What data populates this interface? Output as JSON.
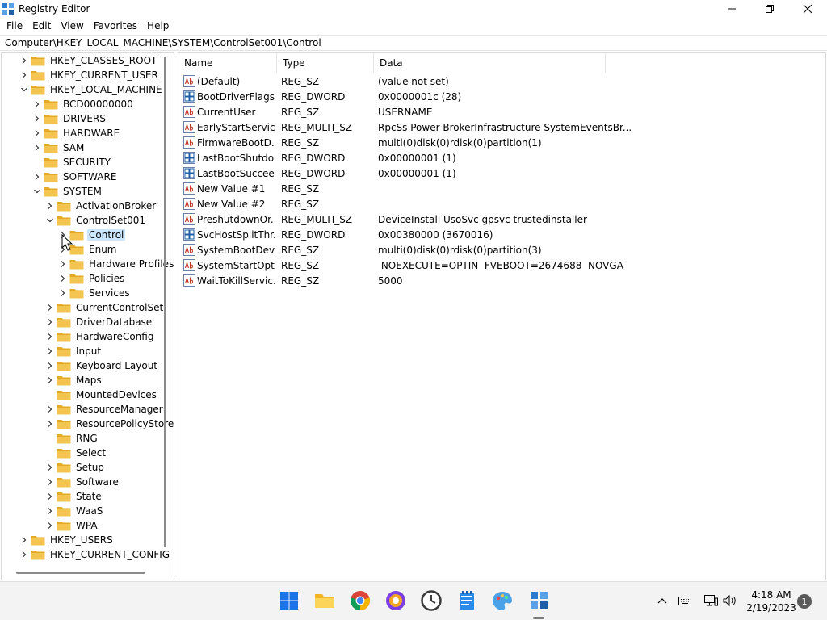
{
  "window": {
    "title": "Registry Editor"
  },
  "menu": [
    "File",
    "Edit",
    "View",
    "Favorites",
    "Help"
  ],
  "address": "Computer\\HKEY_LOCAL_MACHINE\\SYSTEM\\ControlSet001\\Control",
  "tree": [
    {
      "label": "HKEY_CLASSES_ROOT",
      "level": 0,
      "expander": "collapsed"
    },
    {
      "label": "HKEY_CURRENT_USER",
      "level": 0,
      "expander": "collapsed"
    },
    {
      "label": "HKEY_LOCAL_MACHINE",
      "level": 0,
      "expander": "expanded"
    },
    {
      "label": "BCD00000000",
      "level": 1,
      "expander": "collapsed"
    },
    {
      "label": "DRIVERS",
      "level": 1,
      "expander": "collapsed"
    },
    {
      "label": "HARDWARE",
      "level": 1,
      "expander": "collapsed"
    },
    {
      "label": "SAM",
      "level": 1,
      "expander": "collapsed"
    },
    {
      "label": "SECURITY",
      "level": 1,
      "expander": "none"
    },
    {
      "label": "SOFTWARE",
      "level": 1,
      "expander": "collapsed"
    },
    {
      "label": "SYSTEM",
      "level": 1,
      "expander": "expanded"
    },
    {
      "label": "ActivationBroker",
      "level": 2,
      "expander": "collapsed"
    },
    {
      "label": "ControlSet001",
      "level": 2,
      "expander": "expanded"
    },
    {
      "label": "Control",
      "level": 3,
      "expander": "collapsed",
      "selected": true
    },
    {
      "label": "Enum",
      "level": 3,
      "expander": "collapsed"
    },
    {
      "label": "Hardware Profiles",
      "level": 3,
      "expander": "collapsed"
    },
    {
      "label": "Policies",
      "level": 3,
      "expander": "collapsed"
    },
    {
      "label": "Services",
      "level": 3,
      "expander": "collapsed"
    },
    {
      "label": "CurrentControlSet",
      "level": 2,
      "expander": "collapsed"
    },
    {
      "label": "DriverDatabase",
      "level": 2,
      "expander": "collapsed"
    },
    {
      "label": "HardwareConfig",
      "level": 2,
      "expander": "collapsed"
    },
    {
      "label": "Input",
      "level": 2,
      "expander": "collapsed"
    },
    {
      "label": "Keyboard Layout",
      "level": 2,
      "expander": "collapsed"
    },
    {
      "label": "Maps",
      "level": 2,
      "expander": "collapsed"
    },
    {
      "label": "MountedDevices",
      "level": 2,
      "expander": "none"
    },
    {
      "label": "ResourceManager",
      "level": 2,
      "expander": "collapsed"
    },
    {
      "label": "ResourcePolicyStore",
      "level": 2,
      "expander": "collapsed"
    },
    {
      "label": "RNG",
      "level": 2,
      "expander": "none"
    },
    {
      "label": "Select",
      "level": 2,
      "expander": "none"
    },
    {
      "label": "Setup",
      "level": 2,
      "expander": "collapsed"
    },
    {
      "label": "Software",
      "level": 2,
      "expander": "collapsed"
    },
    {
      "label": "State",
      "level": 2,
      "expander": "collapsed"
    },
    {
      "label": "WaaS",
      "level": 2,
      "expander": "collapsed"
    },
    {
      "label": "WPA",
      "level": 2,
      "expander": "collapsed"
    },
    {
      "label": "HKEY_USERS",
      "level": 0,
      "expander": "collapsed"
    },
    {
      "label": "HKEY_CURRENT_CONFIG",
      "level": 0,
      "expander": "collapsed"
    }
  ],
  "columns": [
    "Name",
    "Type",
    "Data"
  ],
  "values": [
    {
      "icon": "string",
      "name": "(Default)",
      "type": "REG_SZ",
      "data": "(value not set)"
    },
    {
      "icon": "binary",
      "name": "BootDriverFlags",
      "type": "REG_DWORD",
      "data": "0x0000001c (28)"
    },
    {
      "icon": "string",
      "name": "CurrentUser",
      "type": "REG_SZ",
      "data": "USERNAME"
    },
    {
      "icon": "string",
      "name": "EarlyStartServices",
      "type": "REG_MULTI_SZ",
      "data": "RpcSs Power BrokerInfrastructure SystemEventsBr..."
    },
    {
      "icon": "string",
      "name": "FirmwareBootD...",
      "type": "REG_SZ",
      "data": "multi(0)disk(0)rdisk(0)partition(1)"
    },
    {
      "icon": "binary",
      "name": "LastBootShutdo...",
      "type": "REG_DWORD",
      "data": "0x00000001 (1)"
    },
    {
      "icon": "binary",
      "name": "LastBootSuccee...",
      "type": "REG_DWORD",
      "data": "0x00000001 (1)"
    },
    {
      "icon": "string",
      "name": "New Value #1",
      "type": "REG_SZ",
      "data": ""
    },
    {
      "icon": "string",
      "name": "New Value #2",
      "type": "REG_SZ",
      "data": ""
    },
    {
      "icon": "string",
      "name": "PreshutdownOr...",
      "type": "REG_MULTI_SZ",
      "data": "DeviceInstall UsoSvc gpsvc trustedinstaller"
    },
    {
      "icon": "binary",
      "name": "SvcHostSplitThr...",
      "type": "REG_DWORD",
      "data": "0x00380000 (3670016)"
    },
    {
      "icon": "string",
      "name": "SystemBootDevi...",
      "type": "REG_SZ",
      "data": "multi(0)disk(0)rdisk(0)partition(3)"
    },
    {
      "icon": "string",
      "name": "SystemStartOpti...",
      "type": "REG_SZ",
      "data": " NOEXECUTE=OPTIN  FVEBOOT=2674688  NOVGA"
    },
    {
      "icon": "string",
      "name": "WaitToKillServic...",
      "type": "REG_SZ",
      "data": "5000"
    }
  ],
  "taskbar": {
    "apps": [
      "start-icon",
      "file-explorer-icon",
      "chrome-icon",
      "browser-icon",
      "clock-app-icon",
      "notepad-icon",
      "paint-icon",
      "regedit-icon"
    ],
    "time": "4:18 AM",
    "date": "2/19/2023",
    "notifications": "1"
  },
  "colors": {
    "selection": "#cce8ff",
    "folder": "#f3c44f",
    "taskbar": "#f3f3f3"
  }
}
